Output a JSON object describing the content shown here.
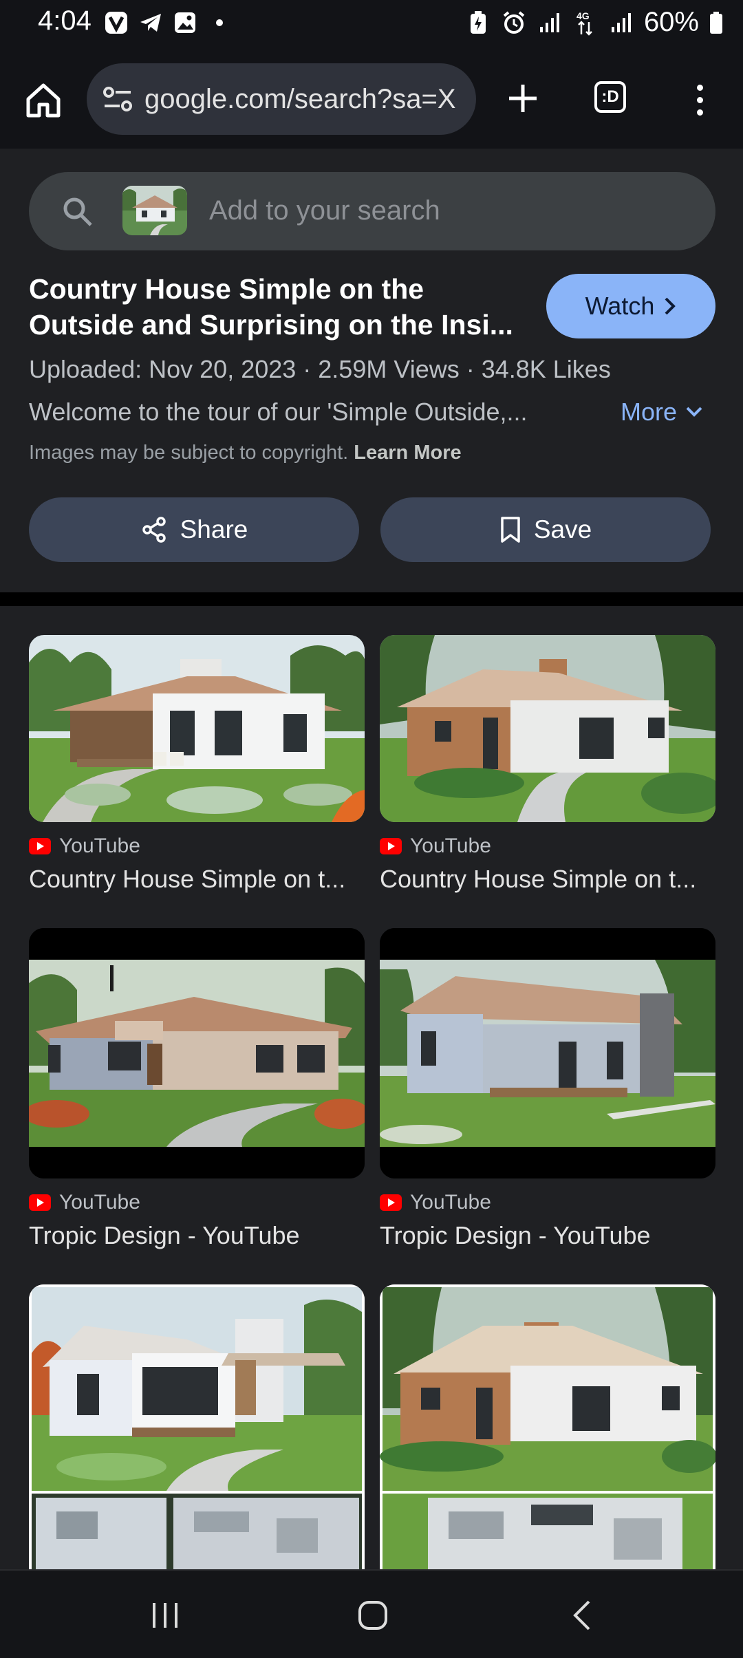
{
  "status_bar": {
    "time": "4:04",
    "battery": "60%",
    "left_icons": [
      "vibrate-app-icon",
      "telegram-icon",
      "gallery-icon",
      "dot-icon"
    ],
    "right_icons": [
      "battery-saver-icon",
      "alarm-icon",
      "signal-icon",
      "4g-icon",
      "signal-icon",
      "battery-icon"
    ]
  },
  "browser": {
    "url": "google.com/search?sa=X",
    "tabs_label": ":D"
  },
  "search": {
    "placeholder": "Add to your search"
  },
  "result": {
    "title": "Country House Simple on the Outside and Surprising on the Insi...",
    "watch_label": "Watch",
    "meta": "Uploaded: Nov 20, 2023 · 2.59M Views · 34.8K Likes",
    "description": "Welcome to the tour of our 'Simple Outside,...",
    "more_label": "More",
    "copyright_text": "Images may be subject to copyright.",
    "learn_more": "Learn More",
    "share_label": "Share",
    "save_label": "Save"
  },
  "grid": {
    "cards": [
      {
        "source": "YouTube",
        "caption": "Country House Simple on t..."
      },
      {
        "source": "YouTube",
        "caption": "Country House Simple on t..."
      },
      {
        "source": "YouTube",
        "caption": "Tropic Design - YouTube"
      },
      {
        "source": "YouTube",
        "caption": "Tropic Design - YouTube"
      },
      {
        "source": "",
        "caption": ""
      },
      {
        "source": "",
        "caption": ""
      }
    ]
  },
  "colors": {
    "accent": "#8ab4f8",
    "background": "#1f2023",
    "youtube_red": "#ff0000"
  }
}
